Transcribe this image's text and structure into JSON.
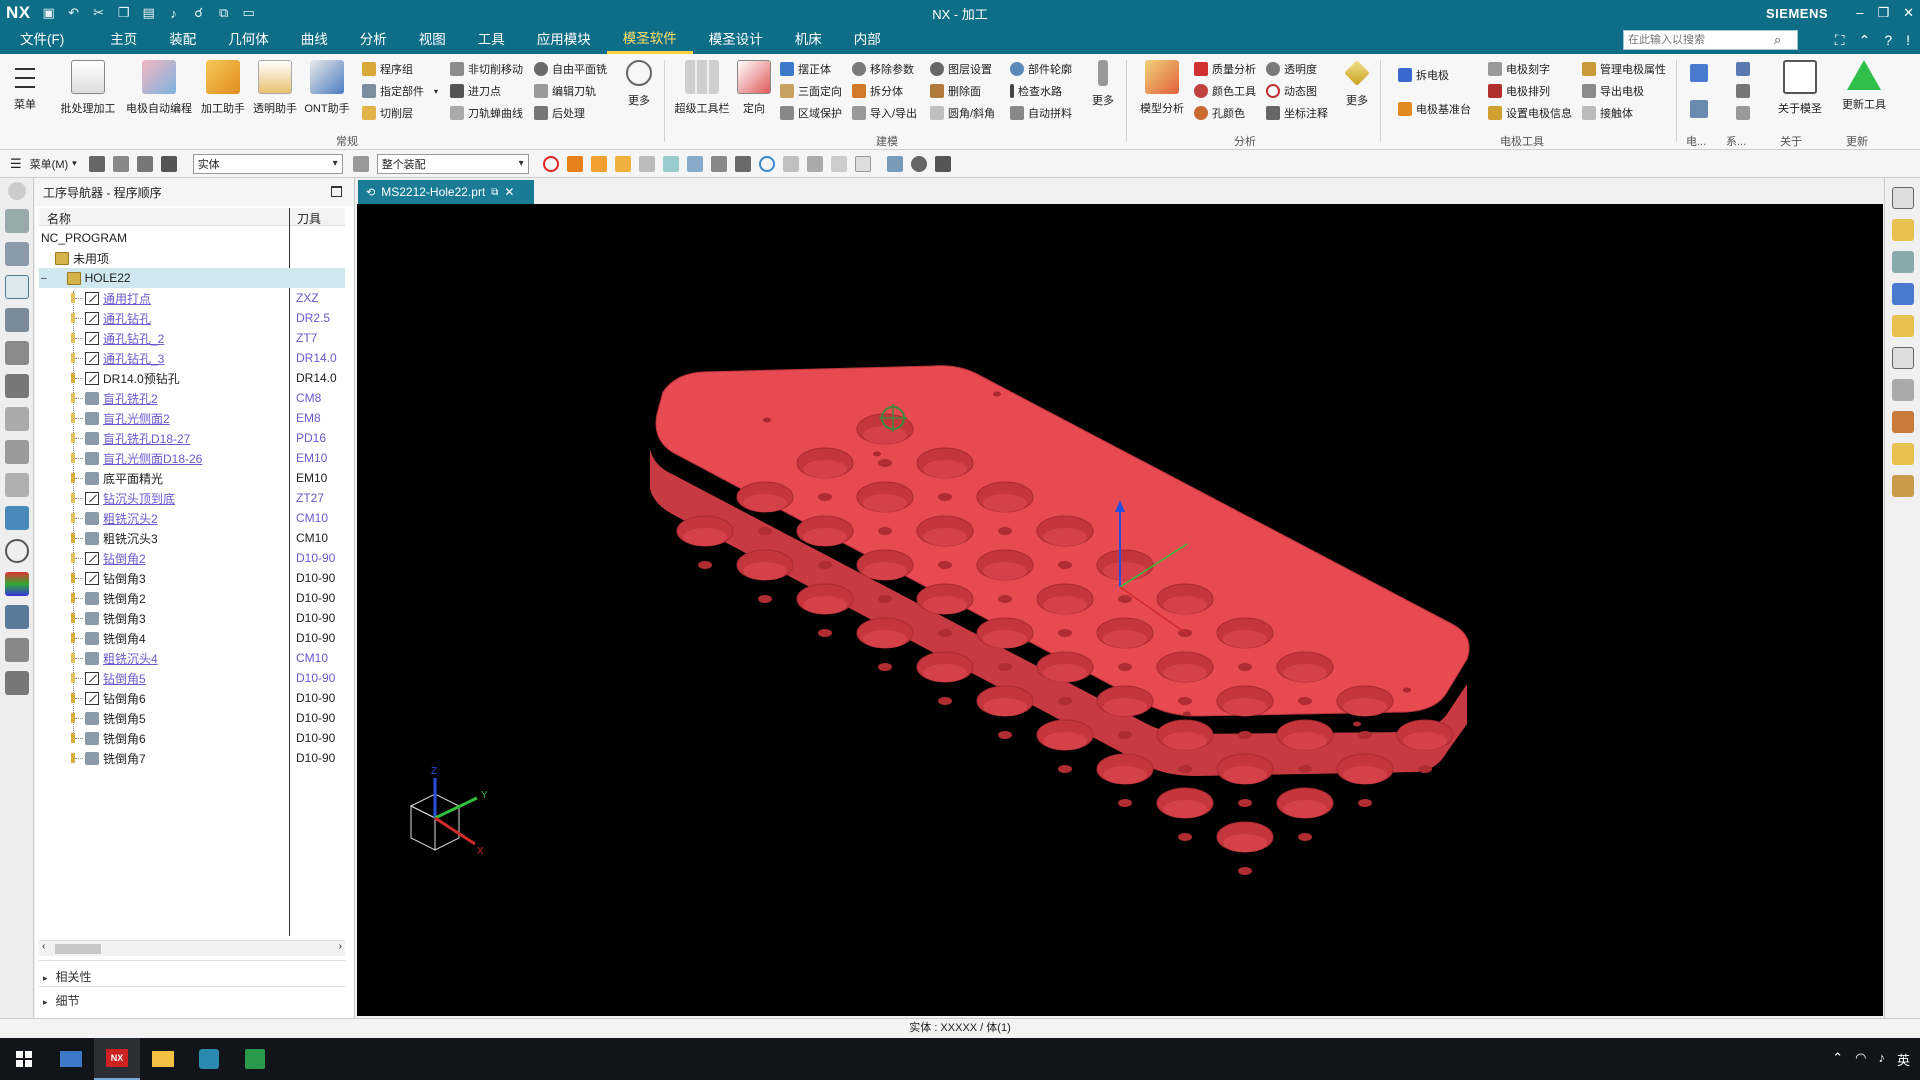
{
  "app": {
    "logo": "NX",
    "title": "NX - 加工",
    "brand": "SIEMENS"
  },
  "menu": {
    "file": "文件(F)",
    "items": [
      "主页",
      "装配",
      "几何体",
      "曲线",
      "分析",
      "视图",
      "工具",
      "应用模块",
      "模圣软件",
      "模圣设计",
      "机床",
      "内部"
    ],
    "active_index": 8,
    "search_placeholder": "在此输入以搜索"
  },
  "ribbon": {
    "menu_btn": "菜单",
    "big_buttons": [
      {
        "label": "批处理加工"
      },
      {
        "label": "电极自动编程"
      },
      {
        "label": "加工助手"
      },
      {
        "label": "透明助手"
      },
      {
        "label": "ONT助手"
      }
    ],
    "group1_small": [
      "程序组",
      "指定部件",
      "切削层",
      "非切削移动",
      "进刀点",
      "刀轨蝉曲线",
      "自由平面铣",
      "编辑刀轨",
      "后处理"
    ],
    "group1_more": "更多",
    "group1_label": "常规",
    "group2_big": [
      "超级工具栏",
      "定向"
    ],
    "group2_small": [
      "摆正体",
      "三面定向",
      "区域保护",
      "移除参数",
      "拆分体",
      "导入/导出",
      "图层设置",
      "删除面",
      "圆角/斜角",
      "部件轮廓",
      "检查水路",
      "自动拼料"
    ],
    "group2_more": "更多",
    "group2_label": "建模",
    "group3_big": [
      "模型分析"
    ],
    "group3_small": [
      "质量分析",
      "颜色工具",
      "孔颜色",
      "透明度",
      "动态图",
      "坐标注释"
    ],
    "group3_more": "更多",
    "group3_label": "分析",
    "group4_small": [
      "拆电极",
      "电极基准台",
      "电极刻字",
      "电极排列",
      "设置电极信息",
      "管理电极属性",
      "导出电极",
      "接触体"
    ],
    "group4_label": "电极工具",
    "group5_labels": [
      "电...",
      "系...",
      "关于",
      "更新"
    ],
    "group5_big": [
      "关于模圣",
      "更新工具"
    ]
  },
  "toolbar2": {
    "menu": "菜单(M)",
    "filter_type": "实体",
    "filter_scope": "整个装配"
  },
  "navigator": {
    "title": "工序导航器 - 程序顺序",
    "col_name": "名称",
    "col_tool": "刀具",
    "root": "NC_PROGRAM",
    "unused": "未用项",
    "group": "HOLE22",
    "rows": [
      {
        "name": "通用打点",
        "tool": "ZXZ",
        "type": "drill",
        "color": "#6a5acd"
      },
      {
        "name": "通孔钻孔",
        "tool": "DR2.5",
        "type": "drill",
        "color": "#6a5acd"
      },
      {
        "name": "通孔钻孔_2",
        "tool": "ZT7",
        "type": "drill",
        "color": "#6a5acd"
      },
      {
        "name": "通孔钻孔_3",
        "tool": "DR14.0",
        "type": "drill",
        "color": "#6a5acd"
      },
      {
        "name": "DR14.0预钻孔",
        "tool": "DR14.0",
        "type": "drill",
        "color": "#222222"
      },
      {
        "name": "盲孔铣孔2",
        "tool": "CM8",
        "type": "mill",
        "color": "#6a5acd"
      },
      {
        "name": "盲孔光侧面2",
        "tool": "EM8",
        "type": "mill",
        "color": "#6a5acd"
      },
      {
        "name": "盲孔铣孔D18-27",
        "tool": "PD16",
        "type": "mill",
        "color": "#6a5acd"
      },
      {
        "name": "盲孔光侧面D18-26",
        "tool": "EM10",
        "type": "mill",
        "color": "#6a5acd"
      },
      {
        "name": "底平面精光",
        "tool": "EM10",
        "type": "mill",
        "color": "#222222"
      },
      {
        "name": "钻沉头顶到底",
        "tool": "ZT27",
        "type": "drill",
        "color": "#6a5acd"
      },
      {
        "name": "粗铣沉头2",
        "tool": "CM10",
        "type": "mill",
        "color": "#6a5acd"
      },
      {
        "name": "粗铣沉头3",
        "tool": "CM10",
        "type": "mill",
        "color": "#222222"
      },
      {
        "name": "钻倒角2",
        "tool": "D10-90",
        "type": "drill",
        "color": "#6a5acd"
      },
      {
        "name": "钻倒角3",
        "tool": "D10-90",
        "type": "drill",
        "color": "#222222"
      },
      {
        "name": "铣倒角2",
        "tool": "D10-90",
        "type": "mill",
        "color": "#222222"
      },
      {
        "name": "铣倒角3",
        "tool": "D10-90",
        "type": "mill",
        "color": "#222222"
      },
      {
        "name": "铣倒角4",
        "tool": "D10-90",
        "type": "mill",
        "color": "#222222"
      },
      {
        "name": "粗铣沉头4",
        "tool": "CM10",
        "type": "mill",
        "color": "#6a5acd"
      },
      {
        "name": "钻倒角5",
        "tool": "D10-90",
        "type": "drill",
        "color": "#6a5acd"
      },
      {
        "name": "钻倒角6",
        "tool": "D10-90",
        "type": "drill",
        "color": "#222222"
      },
      {
        "name": "铣倒角5",
        "tool": "D10-90",
        "type": "mill",
        "color": "#222222"
      },
      {
        "name": "铣倒角6",
        "tool": "D10-90",
        "type": "mill",
        "color": "#222222"
      },
      {
        "name": "铣倒角7",
        "tool": "D10-90",
        "type": "mill",
        "color": "#222222"
      }
    ],
    "acc_relations": "相关性",
    "acc_details": "细节"
  },
  "tab": {
    "label": "MS2212-Hole22.prt"
  },
  "viewport": {
    "part_color": "#e84a52",
    "triad": {
      "x": "X",
      "y": "Y",
      "z": "Z"
    }
  },
  "status": {
    "text": "实体 : XXXXX / 体(1)"
  },
  "taskbar": {
    "lang": "英"
  }
}
